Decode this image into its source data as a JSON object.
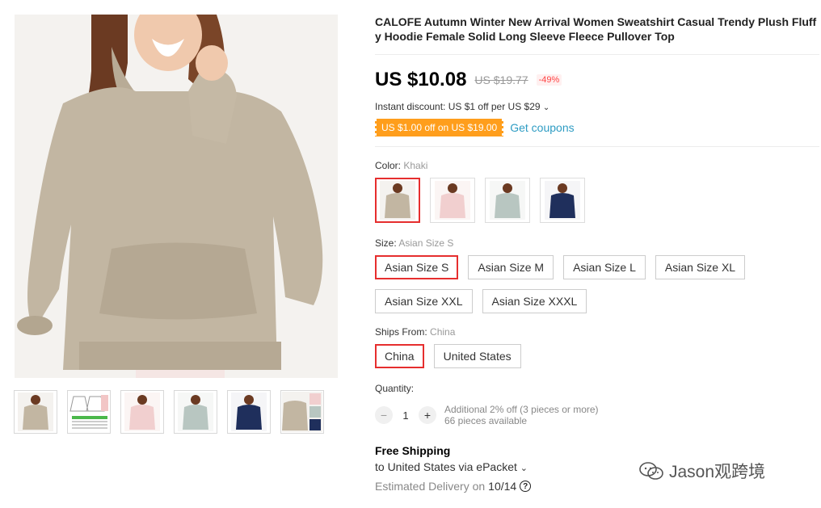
{
  "product": {
    "title": "CALOFE Autumn Winter New Arrival Women Sweatshirt Casual Trendy Plush Fluffy Hoodie Female Solid Long Sleeve Fleece Pullover Top",
    "price": "US $10.08",
    "original_price": "US $19.77",
    "discount": "-49%",
    "instant_discount": "Instant discount: US $1 off per US $29",
    "coupon_tag": "US $1.00 off on US $19.00",
    "get_coupons": "Get coupons"
  },
  "color": {
    "label": "Color:",
    "selected": "Khaki",
    "swatches": [
      {
        "name": "Khaki",
        "hex": "#c2b6a2"
      },
      {
        "name": "Pink",
        "hex": "#f1cfcf"
      },
      {
        "name": "Gray Green",
        "hex": "#b8c6c1"
      },
      {
        "name": "Navy",
        "hex": "#1f2f5c"
      }
    ]
  },
  "size": {
    "label": "Size:",
    "selected": "Asian Size S",
    "options": [
      "Asian Size S",
      "Asian Size M",
      "Asian Size L",
      "Asian Size XL",
      "Asian Size XXL",
      "Asian Size XXXL"
    ]
  },
  "ships": {
    "label": "Ships From:",
    "selected": "China",
    "options": [
      "China",
      "United States"
    ]
  },
  "quantity": {
    "label": "Quantity:",
    "minus": "−",
    "value": "1",
    "plus": "+",
    "note1": "Additional 2% off (3 pieces or more)",
    "note2": "66 pieces available"
  },
  "shipping": {
    "title": "Free Shipping",
    "to": "to United States via ePacket",
    "delivery_prefix": "Estimated Delivery on",
    "delivery_date": "10/14",
    "help": "?"
  },
  "watermark": "Jason观跨境",
  "colors": {
    "accent_red": "#e62e2e",
    "coupon_orange": "#ff9e1c",
    "link_blue": "#2e9cc3",
    "khaki": "#c2b6a2"
  }
}
